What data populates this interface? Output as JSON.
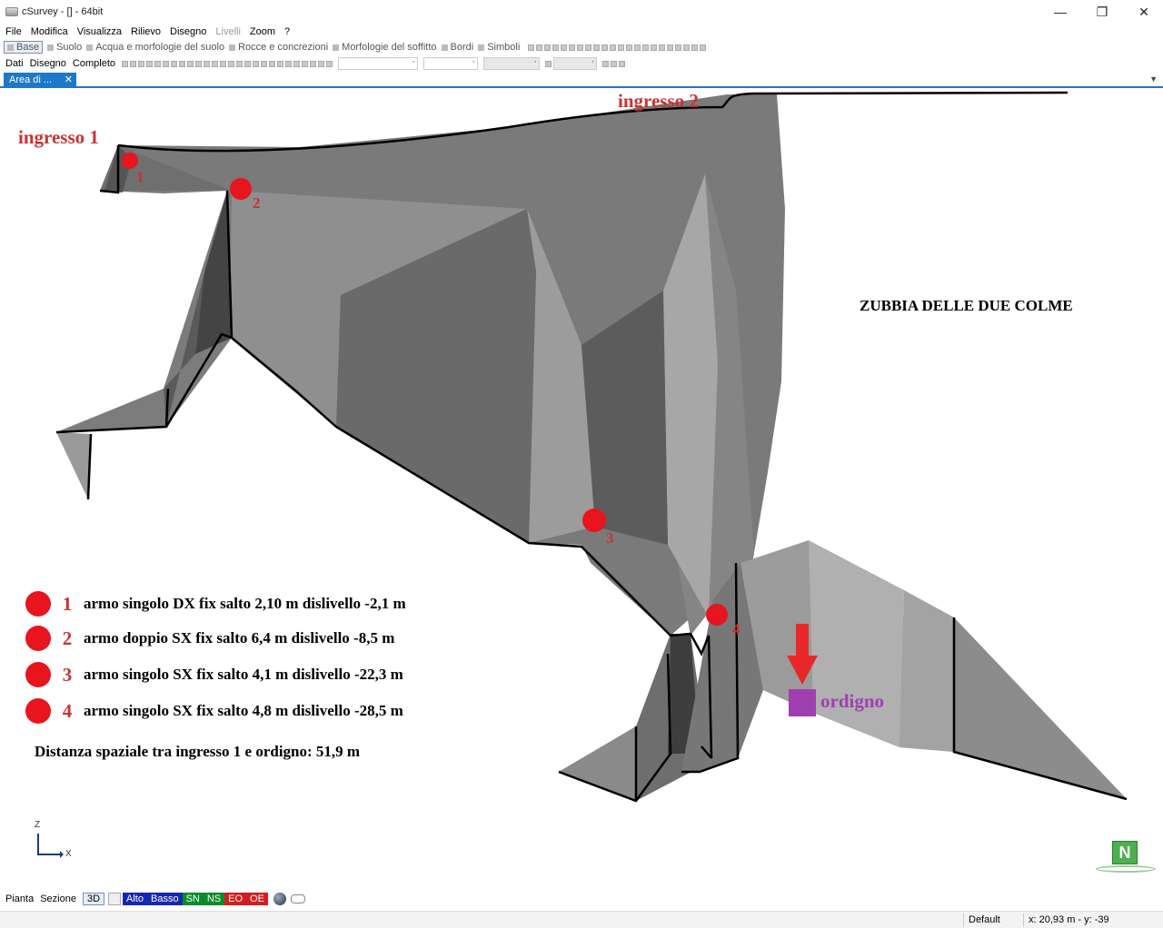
{
  "window": {
    "title": "cSurvey - [] - 64bit",
    "minimize_glyph": "—",
    "restore_glyph": "❐",
    "close_glyph": "✕"
  },
  "menu": [
    "File",
    "Modifica",
    "Visualizza",
    "Rilievo",
    "Disegno",
    "Livelli",
    "Zoom",
    "?"
  ],
  "menu_disabled": [
    "Livelli"
  ],
  "layers_toolbar": [
    "Base",
    "Suolo",
    "Acqua e morfologie del suolo",
    "Rocce e concrezioni",
    "Morfologie del soffitto",
    "Bordi",
    "Simboli"
  ],
  "view_toolbar": [
    "Dati",
    "Disegno",
    "Completo"
  ],
  "document_tab": {
    "label": "Area di ...",
    "close": "✕"
  },
  "tab_scroll_glyph": "▼",
  "labels": {
    "ingresso1": "ingresso 1",
    "ingresso2": "ingresso 2",
    "cave_title": "ZUBBIA DELLE DUE COLME",
    "ordigno": "ordigno",
    "distance": "Distanza spaziale tra ingresso 1 e ordigno: 51,9 m",
    "point_numbers": [
      "1",
      "2",
      "3",
      "4"
    ]
  },
  "legend": [
    {
      "num": "1",
      "text": "armo singolo DX fix salto 2,10 m dislivello  -2,1 m"
    },
    {
      "num": "2",
      "text": "armo doppio SX fix salto 6,4 m dislivello -8,5 m"
    },
    {
      "num": "3",
      "text": "armo singolo SX fix salto 4,1 m dislivello -22,3 m"
    },
    {
      "num": "4",
      "text": "armo singolo SX fix salto 4,8 m dislivello -28,5 m"
    }
  ],
  "axes": {
    "z": "Z",
    "x": "X"
  },
  "north": "N",
  "bottom_bar": {
    "pianta": "Pianta",
    "sezione": "Sezione",
    "btn3d": "3D",
    "alto": "Alto",
    "basso": "Basso",
    "sn": "SN",
    "ns": "NS",
    "eo": "EO",
    "oe": "OE"
  },
  "status": {
    "profile": "Default",
    "coords": "x: 20,93 m - y: -39"
  },
  "colors": {
    "accent": "#1e78c8",
    "marker": "#e8141e",
    "label_red": "#c83232",
    "ordigno": "#a040b0"
  }
}
